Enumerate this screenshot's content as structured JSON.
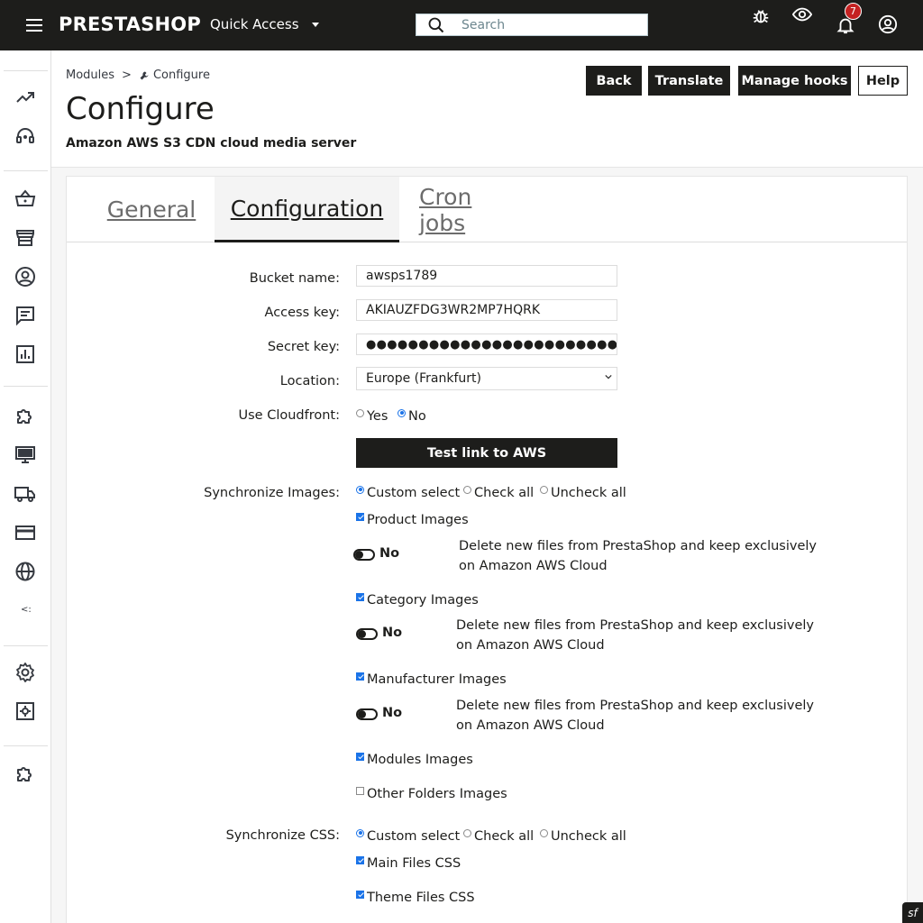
{
  "topbar": {
    "logo": "PRESTASHOP",
    "quick_access": "Quick Access",
    "search_placeholder": "Search",
    "notifications_count": "7",
    "icons": [
      "menu-icon",
      "search-icon",
      "bug-icon",
      "eye-icon",
      "bell-icon",
      "user-circle-icon"
    ]
  },
  "sidebar": {
    "icons": [
      "trending-up-icon",
      "support-headset-icon",
      "basket-icon",
      "store-icon",
      "customer-icon",
      "chat-icon",
      "stats-icon",
      "puzzle-icon",
      "monitor-icon",
      "truck-icon",
      "credit-card-icon",
      "globe-icon",
      "gear-icon",
      "settings-box-icon",
      "puzzle-icon"
    ],
    "collapse_glyph": "<:"
  },
  "header": {
    "breadcrumb": {
      "parent": "Modules",
      "separator": ">",
      "current": "Configure"
    },
    "title": "Configure",
    "subtitle": "Amazon AWS S3 CDN cloud media server",
    "buttons": {
      "back": "Back",
      "translate": "Translate",
      "manage_hooks": "Manage hooks",
      "help": "Help"
    }
  },
  "tabs": [
    {
      "label": "General",
      "active": false
    },
    {
      "label": "Configuration",
      "active": true
    },
    {
      "label": "Cron jobs",
      "active": false
    }
  ],
  "form": {
    "bucket_label": "Bucket name:",
    "bucket_value": "awsps1789",
    "access_label": "Access key:",
    "access_value": "AKIAUZFDG3WR2MP7HQRK",
    "secret_label": "Secret key:",
    "secret_value": "●●●●●●●●●●●●●●●●●●●●●●●●●●●●●●",
    "location_label": "Location:",
    "location_value": "Europe (Frankfurt)",
    "cloudfront_label": "Use Cloudfront:",
    "cloudfront_yes": "Yes",
    "cloudfront_no": "No",
    "test_button": "Test link to AWS"
  },
  "sync_images": {
    "label": "Synchronize Images:",
    "custom": "Custom select",
    "check_all": "Check all",
    "uncheck_all": "Uncheck all",
    "items": [
      {
        "label": "Product Images",
        "toggle": "No",
        "help": "Delete new files from PrestaShop and keep exclusively on Amazon AWS Cloud"
      },
      {
        "label": "Category Images",
        "toggle": "No",
        "help": "Delete new files from PrestaShop and keep exclusively on Amazon AWS Cloud"
      },
      {
        "label": "Manufacturer Images",
        "toggle": "No",
        "help": "Delete new files from PrestaShop and keep exclusively on Amazon AWS Cloud"
      }
    ],
    "modules": "Modules Images",
    "other": "Other Folders Images"
  },
  "sync_css": {
    "label": "Synchronize CSS:",
    "custom": "Custom select",
    "check_all": "Check all",
    "uncheck_all": "Uncheck all",
    "main": "Main Files CSS",
    "theme": "Theme Files CSS"
  },
  "symfony_badge": "sf",
  "colors": {
    "topbar": "#1d1d1b",
    "accent_blue": "#1a73e8",
    "badge_red": "#c42121"
  }
}
